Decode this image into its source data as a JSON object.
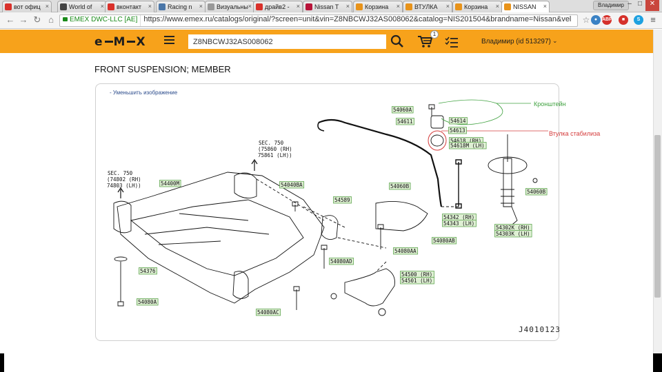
{
  "browser": {
    "tabs": [
      {
        "label": "вот офиц",
        "favicon": "yandex-icon",
        "color": "#d9312b"
      },
      {
        "label": "World of",
        "favicon": "wot-icon",
        "color": "#444444"
      },
      {
        "label": "вконтакт",
        "favicon": "yandex-icon",
        "color": "#d9312b"
      },
      {
        "label": "Racing n",
        "favicon": "vk-icon",
        "color": "#4a76a8"
      },
      {
        "label": "Визуальны",
        "favicon": "doc-icon",
        "color": "#999999"
      },
      {
        "label": "драйв2 -",
        "favicon": "yandex-icon",
        "color": "#d9312b"
      },
      {
        "label": "Nissan T",
        "favicon": "d-icon",
        "color": "#b8143a"
      },
      {
        "label": "Корзина",
        "favicon": "emex-icon",
        "color": "#e8931a"
      },
      {
        "label": "ВТУЛКА",
        "favicon": "emex-icon",
        "color": "#e8931a"
      },
      {
        "label": "Корзина",
        "favicon": "emex-icon",
        "color": "#e8931a"
      },
      {
        "label": "NISSAN",
        "favicon": "emex-icon",
        "color": "#e8931a"
      }
    ],
    "user_chip": "Владимир",
    "ev_label": "EMEX DWC-LLC [AE]",
    "url": "https://www.emex.ru/catalogs/original/?screen=unit&vin=Z8NBCWJ32AS008062&catalog=NIS201504&brandname=Nissan&vel"
  },
  "site": {
    "logo_left": "e",
    "logo_mid": "M",
    "logo_right": "X",
    "search_value": "Z8NBCWJ32AS008062",
    "cart_count": "1",
    "user_label": "Владимир (id 513297)",
    "accent": "#f7a21b"
  },
  "page": {
    "title": "FRONT SUSPENSION; MEMBER",
    "shrink_link": "- Уменьшить изображение",
    "annotation_bracket": "Кронштейн",
    "annotation_bushing": "Втулка стабилиза",
    "diagram_code": "J4010123",
    "sec_refs": [
      {
        "title": "SEC. 750",
        "rh": "(74802 (RH)",
        "lh": " 74803 (LH))"
      },
      {
        "title": "SEC. 750",
        "rh": "(75860 (RH)",
        "lh": " 75861 (LH))"
      }
    ],
    "parts": [
      "54400M",
      "54040BA",
      "54589",
      "54376",
      "54080A",
      "54080AC",
      "54080AD",
      "54060A",
      "54611",
      "54614",
      "54613",
      "54618 (RH)",
      "54618M (LH)",
      "54060B",
      "54060B",
      "54342 (RH)",
      "54343 (LH)",
      "54080AB",
      "54080AA",
      "54500 (RH)",
      "54501 (LH)",
      "54302K (RH)",
      "54303K (LH)"
    ]
  }
}
